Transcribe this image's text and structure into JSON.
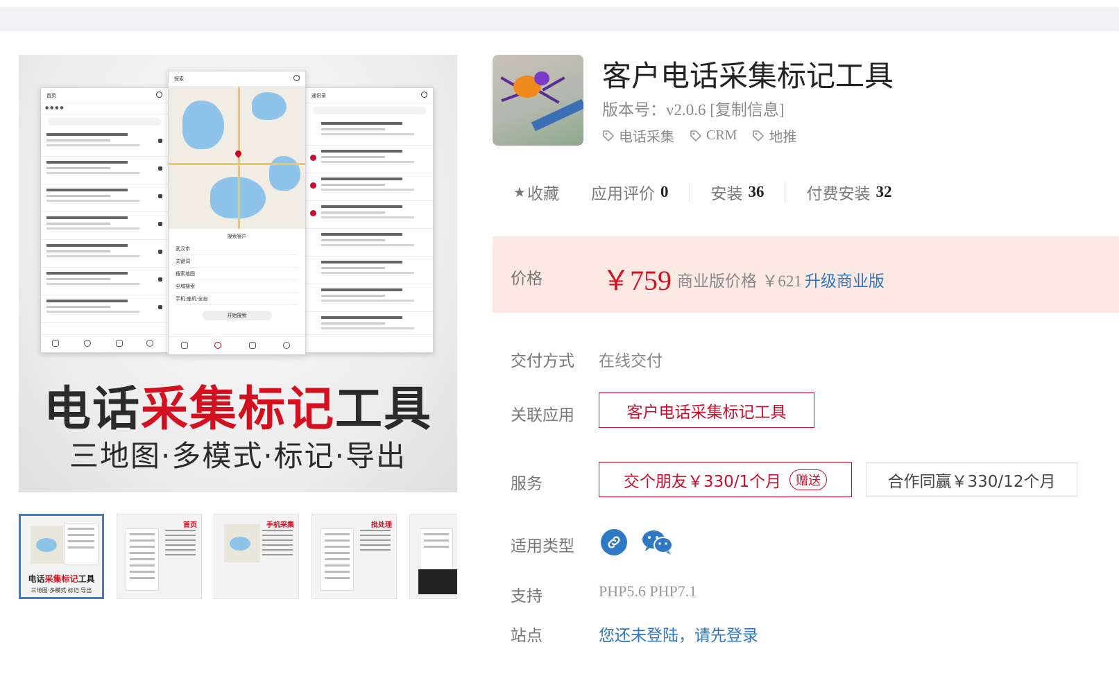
{
  "gallery": {
    "hero": {
      "phone1_title": "首页",
      "phone2_title": "探索",
      "phone3_title": "通讯录",
      "sheet_title": "搜索客户",
      "sheet_items": [
        "武汉市",
        "关键词",
        "搜索地图",
        "全城搜索",
        "手机·座机·全自"
      ],
      "sheet_button": "开始搜索",
      "title_prefix": "电话",
      "title_highlight": "采集标记",
      "title_suffix": "工具",
      "subtitle": "三地图·多模式·标记·导出"
    },
    "thumbnails": [
      {
        "title_prefix": "电话",
        "title_highlight": "采集标记",
        "title_suffix": "工具",
        "subtitle": "三地图·多模式·标记·导出",
        "active": true
      },
      {
        "caption": "首页"
      },
      {
        "caption": "手机采集"
      },
      {
        "caption": "批处理"
      },
      {
        "caption": ""
      }
    ]
  },
  "app": {
    "title": "客户电话采集标记工具",
    "version_label": "版本号：",
    "version": "v2.0.6",
    "copy_info": "[复制信息]",
    "tags": [
      "电话采集",
      "CRM",
      "地推"
    ]
  },
  "stats": {
    "favorite": "收藏",
    "rating_label": "应用评价",
    "rating": "0",
    "install_label": "安装",
    "installs": "36",
    "paid_label": "付费安装",
    "paid_installs": "32"
  },
  "price": {
    "label": "价格",
    "main": "￥759",
    "pro_label": "商业版价格",
    "pro_price": "￥621",
    "upgrade": "升级商业版"
  },
  "fields": {
    "delivery_label": "交付方式",
    "delivery_value": "在线交付",
    "related_label": "关联应用",
    "related_app": "客户电话采集标记工具",
    "service_label": "服务",
    "service1": "交个朋友￥330/1个月",
    "service1_badge": "赠送",
    "service2": "合作同赢￥330/12个月",
    "types_label": "适用类型",
    "types": [
      "link-icon",
      "wechat-icon"
    ],
    "support_label": "支持",
    "support_value": "PHP5.6 PHP7.1",
    "site_label": "站点",
    "site_value": "您还未登陆，请先登录"
  },
  "colors": {
    "accent_red": "#d3101f",
    "link_blue": "#2f78c4",
    "price_bg": "#fde9e4"
  }
}
